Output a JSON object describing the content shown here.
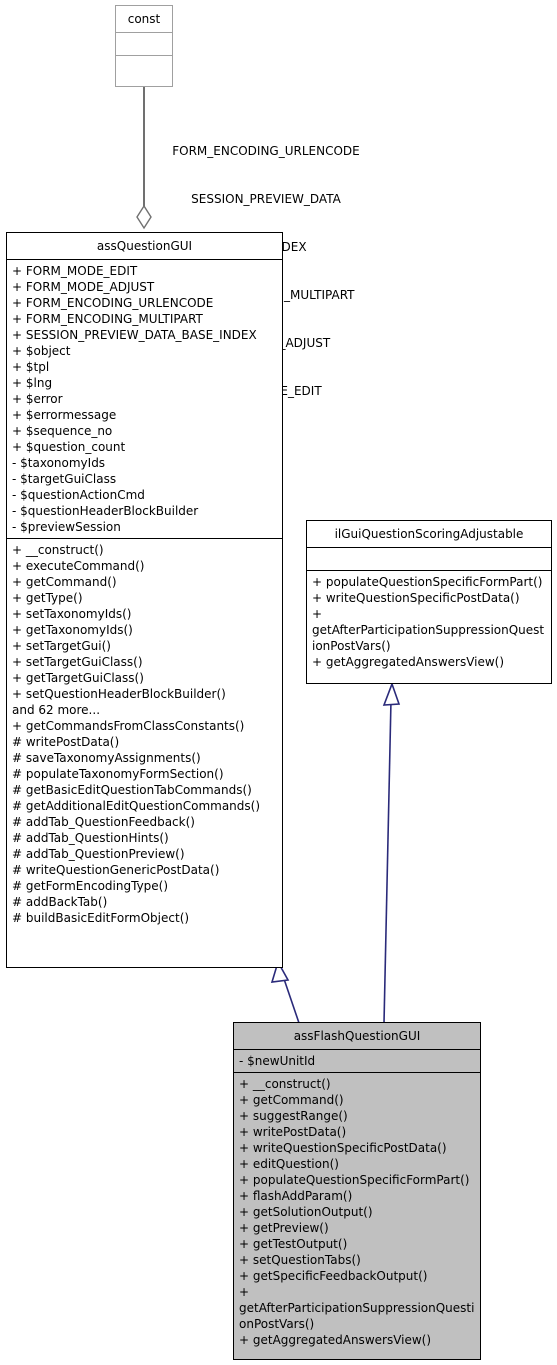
{
  "diagram": {
    "kind": "uml-class-diagram",
    "background": "#ffffff",
    "edge_color": "#2a2a7a",
    "aggregation_line_color": "#707070",
    "filled_node_color": "#c0c0c0"
  },
  "const_node": {
    "title": "const",
    "attributes": [],
    "methods": []
  },
  "aggregation_label": {
    "lines": [
      "FORM_ENCODING_URLENCODE",
      "SESSION_PREVIEW_DATA",
      "_BASE_INDEX",
      "FORM_ENCODING_MULTIPART",
      "FORM_MODE_ADJUST",
      "FORM_MODE_EDIT"
    ]
  },
  "ass_question_gui": {
    "title": "assQuestionGUI",
    "attributes": [
      "+ FORM_MODE_EDIT",
      "+ FORM_MODE_ADJUST",
      "+ FORM_ENCODING_URLENCODE",
      "+ FORM_ENCODING_MULTIPART",
      "+ SESSION_PREVIEW_DATA_BASE_INDEX",
      "+ $object",
      "+ $tpl",
      "+ $lng",
      "+ $error",
      "+ $errormessage",
      "+ $sequence_no",
      "+ $question_count",
      "- $taxonomyIds",
      "- $targetGuiClass",
      "- $questionActionCmd",
      "- $questionHeaderBlockBuilder",
      "- $previewSession"
    ],
    "methods": [
      "+ __construct()",
      "+ executeCommand()",
      "+ getCommand()",
      "+ getType()",
      "+ setTaxonomyIds()",
      "+ getTaxonomyIds()",
      "+ setTargetGui()",
      "+ setTargetGuiClass()",
      "+ getTargetGuiClass()",
      "+ setQuestionHeaderBlockBuilder()",
      "and 62 more...",
      "+ getCommandsFromClassConstants()",
      "# writePostData()",
      "# saveTaxonomyAssignments()",
      "# populateTaxonomyFormSection()",
      "# getBasicEditQuestionTabCommands()",
      "# getAdditionalEditQuestionCommands()",
      "# addTab_QuestionFeedback()",
      "# addTab_QuestionHints()",
      "# addTab_QuestionPreview()",
      "# writeQuestionGenericPostData()",
      "# getFormEncodingType()",
      "# addBackTab()",
      "# buildBasicEditFormObject()"
    ]
  },
  "il_gui_question_scoring_adjustable": {
    "title": "ilGuiQuestionScoringAdjustable",
    "attributes": [],
    "methods": [
      "+ populateQuestionSpecificFormPart()",
      "+ writeQuestionSpecificPostData()",
      "+ getAfterParticipationSuppressionQuestionPostVars()",
      "+ getAggregatedAnswersView()"
    ]
  },
  "ass_flash_question_gui": {
    "title": "assFlashQuestionGUI",
    "attributes": [
      "- $newUnitId"
    ],
    "methods": [
      "+ __construct()",
      "+ getCommand()",
      "+ suggestRange()",
      "+ writePostData()",
      "+ writeQuestionSpecificPostData()",
      "+ editQuestion()",
      "+ populateQuestionSpecificFormPart()",
      "+ flashAddParam()",
      "+ getSolutionOutput()",
      "+ getPreview()",
      "+ getTestOutput()",
      "+ setQuestionTabs()",
      "+ getSpecificFeedbackOutput()",
      "+ getAfterParticipationSuppressionQuestionPostVars()",
      "+ getAggregatedAnswersView()"
    ]
  },
  "relations": [
    {
      "name": "const-aggregates-assQuestionGUI",
      "type": "aggregation",
      "from": "const",
      "to": "assQuestionGUI"
    },
    {
      "name": "assFlashQuestionGUI-extends-assQuestionGUI",
      "type": "inheritance",
      "from": "assFlashQuestionGUI",
      "to": "assQuestionGUI"
    },
    {
      "name": "assFlashQuestionGUI-implements-ilGuiQuestionScoringAdjustable",
      "type": "realization",
      "from": "assFlashQuestionGUI",
      "to": "ilGuiQuestionScoringAdjustable"
    }
  ]
}
